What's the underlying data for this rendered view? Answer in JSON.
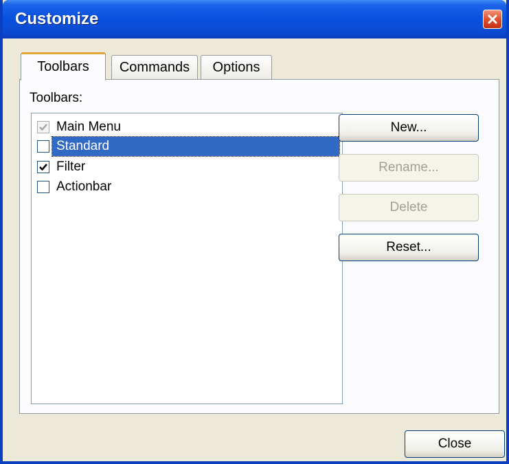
{
  "window": {
    "title": "Customize"
  },
  "tabs": [
    {
      "label": "Toolbars",
      "active": true
    },
    {
      "label": "Commands",
      "active": false
    },
    {
      "label": "Options",
      "active": false
    }
  ],
  "panel": {
    "list_label": "Toolbars:",
    "items": [
      {
        "label": "Main Menu",
        "checked": true,
        "disabled": true,
        "selected": false
      },
      {
        "label": "Standard",
        "checked": false,
        "disabled": false,
        "selected": true
      },
      {
        "label": "Filter",
        "checked": true,
        "disabled": false,
        "selected": false
      },
      {
        "label": "Actionbar",
        "checked": false,
        "disabled": false,
        "selected": false
      }
    ]
  },
  "buttons": {
    "new": "New...",
    "rename": "Rename...",
    "delete": "Delete",
    "reset": "Reset...",
    "close": "Close"
  },
  "colors": {
    "titlebar": "#0a52df",
    "selection": "#316ac5",
    "active_tab_accent": "#e6a23a"
  }
}
